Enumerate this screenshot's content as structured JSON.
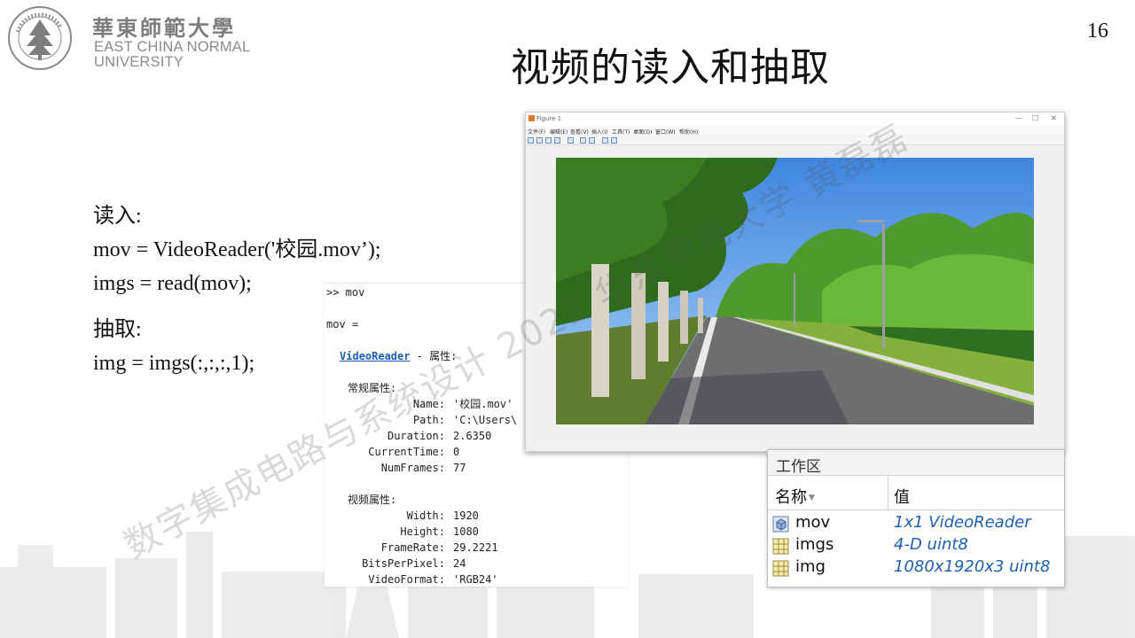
{
  "logo": {
    "cn": "華東師範大學",
    "en_line1": "EAST CHINA NORMAL",
    "en_line2": "UNIVERSITY"
  },
  "page_number": "16",
  "title": "视频的读入和抽取",
  "code": {
    "read_heading": "读入:",
    "read_line1": "mov = VideoReader('校园.mov’);",
    "read_line2": "imgs = read(mov);",
    "extract_heading": "抽取:",
    "extract_line1": "img = imgs(:,:,:,1);"
  },
  "console": {
    "prompt": ">> mov",
    "assign": "mov =",
    "class_link": "VideoReader",
    "class_suffix": " - 属性:",
    "general_heading": "常规属性:",
    "general": [
      {
        "key": "Name:",
        "value": "'校园.mov'"
      },
      {
        "key": "Path:",
        "value": "'C:\\Users\\"
      },
      {
        "key": "Duration:",
        "value": "2.6350"
      },
      {
        "key": "CurrentTime:",
        "value": "0"
      },
      {
        "key": "NumFrames:",
        "value": "77"
      }
    ],
    "video_heading": "视频属性:",
    "video": [
      {
        "key": "Width:",
        "value": "1920"
      },
      {
        "key": "Height:",
        "value": "1080"
      },
      {
        "key": "FrameRate:",
        "value": "29.2221"
      },
      {
        "key": "BitsPerPixel:",
        "value": "24"
      },
      {
        "key": "VideoFormat:",
        "value": "'RGB24'"
      }
    ]
  },
  "figure": {
    "title": "Figure 1",
    "controls": [
      "—",
      "☐",
      "✕"
    ],
    "menu": [
      "文件(F)",
      "编辑(E)",
      "查看(V)",
      "插入(I)",
      "工具(T)",
      "桌面(D)",
      "窗口(W)",
      "帮助(H)"
    ]
  },
  "workspace": {
    "title": "工作区",
    "col_name": "名称",
    "col_value": "值",
    "rows": [
      {
        "name": "mov",
        "value": "1x1 VideoReader",
        "icon": "object-icon"
      },
      {
        "name": "imgs",
        "value": "4-D uint8",
        "icon": "matrix-icon"
      },
      {
        "name": "img",
        "value": "1080x1920x3 uint8",
        "icon": "matrix-icon"
      }
    ]
  },
  "watermark": "数字集成电路与系统设计 2023 华东师范大学 黄磊磊"
}
